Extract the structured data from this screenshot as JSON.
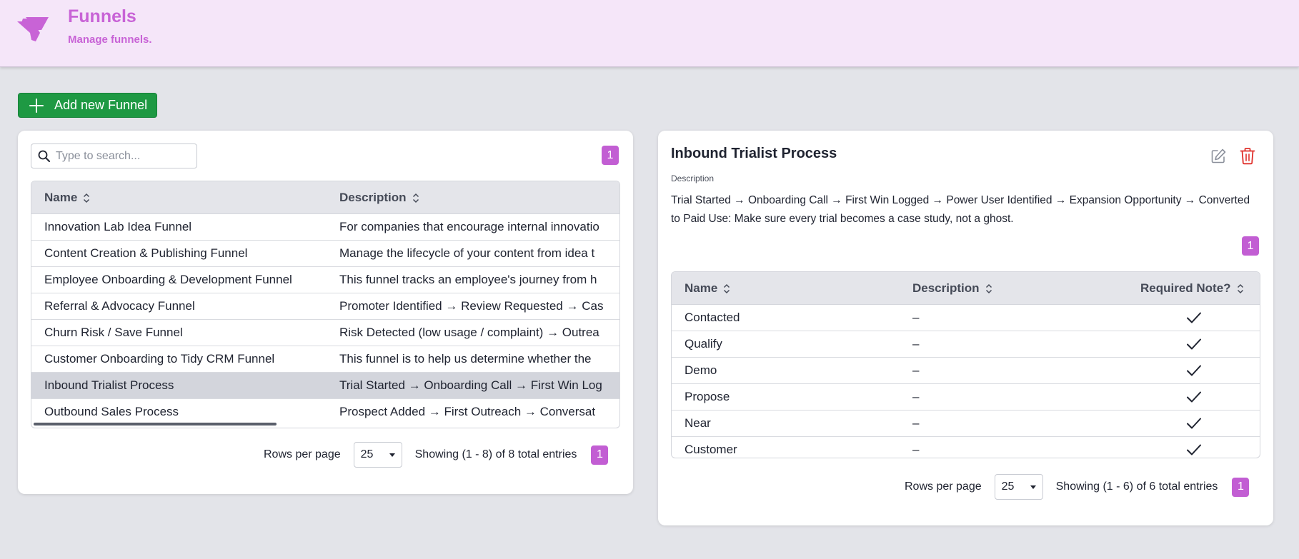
{
  "header": {
    "icon": "funnel-icon",
    "title": "Funnels",
    "subtitle": "Manage funnels."
  },
  "toolbar": {
    "add_label": "Add new Funnel"
  },
  "funnel_list": {
    "search_placeholder": "Type to search...",
    "page_badge": "1",
    "columns": [
      "Name",
      "Description"
    ],
    "rows": [
      {
        "name": "Innovation Lab Idea Funnel",
        "description": "For companies that encourage internal innovatio"
      },
      {
        "name": "Content Creation & Publishing Funnel",
        "description": "Manage the lifecycle of your content from idea t"
      },
      {
        "name": "Employee Onboarding & Development Funnel",
        "description": "This funnel tracks an employee's journey from h"
      },
      {
        "name": "Referral & Advocacy Funnel",
        "description": "Promoter Identified → Review Requested → Cas"
      },
      {
        "name": "Churn Risk / Save Funnel",
        "description": "Risk Detected (low usage / complaint) → Outrea"
      },
      {
        "name": "Customer Onboarding to Tidy CRM Funnel",
        "description": "This funnel is to help us determine whether the"
      },
      {
        "name": "Inbound Trialist Process",
        "description": "Trial Started → Onboarding Call → First Win Log"
      },
      {
        "name": "Outbound Sales Process",
        "description": "Prospect Added → First Outreach → Conversat"
      }
    ],
    "selected_index": 6,
    "pager": {
      "rows_per_page_label": "Rows per page",
      "rows_per_page": "25",
      "showing": "Showing (1 - 8) of 8 total entries",
      "page": "1"
    }
  },
  "detail": {
    "title": "Inbound Trialist Process",
    "description_label": "Description",
    "description": "Trial Started → Onboarding Call → First Win Logged → Power User Identified → Expansion Opportunity → Converted to Paid Use: Make sure every trial becomes a case study, not a ghost.",
    "page_badge": "1",
    "columns": [
      "Name",
      "Description",
      "Required Note?"
    ],
    "stages": [
      {
        "name": "Contacted",
        "description": "–",
        "required": true
      },
      {
        "name": "Qualify",
        "description": "–",
        "required": true
      },
      {
        "name": "Demo",
        "description": "–",
        "required": true
      },
      {
        "name": "Propose",
        "description": "–",
        "required": true
      },
      {
        "name": "Near",
        "description": "–",
        "required": true
      },
      {
        "name": "Customer",
        "description": "–",
        "required": true
      }
    ],
    "pager": {
      "rows_per_page_label": "Rows per page",
      "rows_per_page": "25",
      "showing": "Showing (1 - 6) of 6 total entries",
      "page": "1"
    }
  },
  "colors": {
    "brand": "#c863d6",
    "badge": "#c25ed3",
    "add_button": "#1e9943",
    "delete": "#e0302b",
    "header_bg": "#f5e6f9"
  }
}
